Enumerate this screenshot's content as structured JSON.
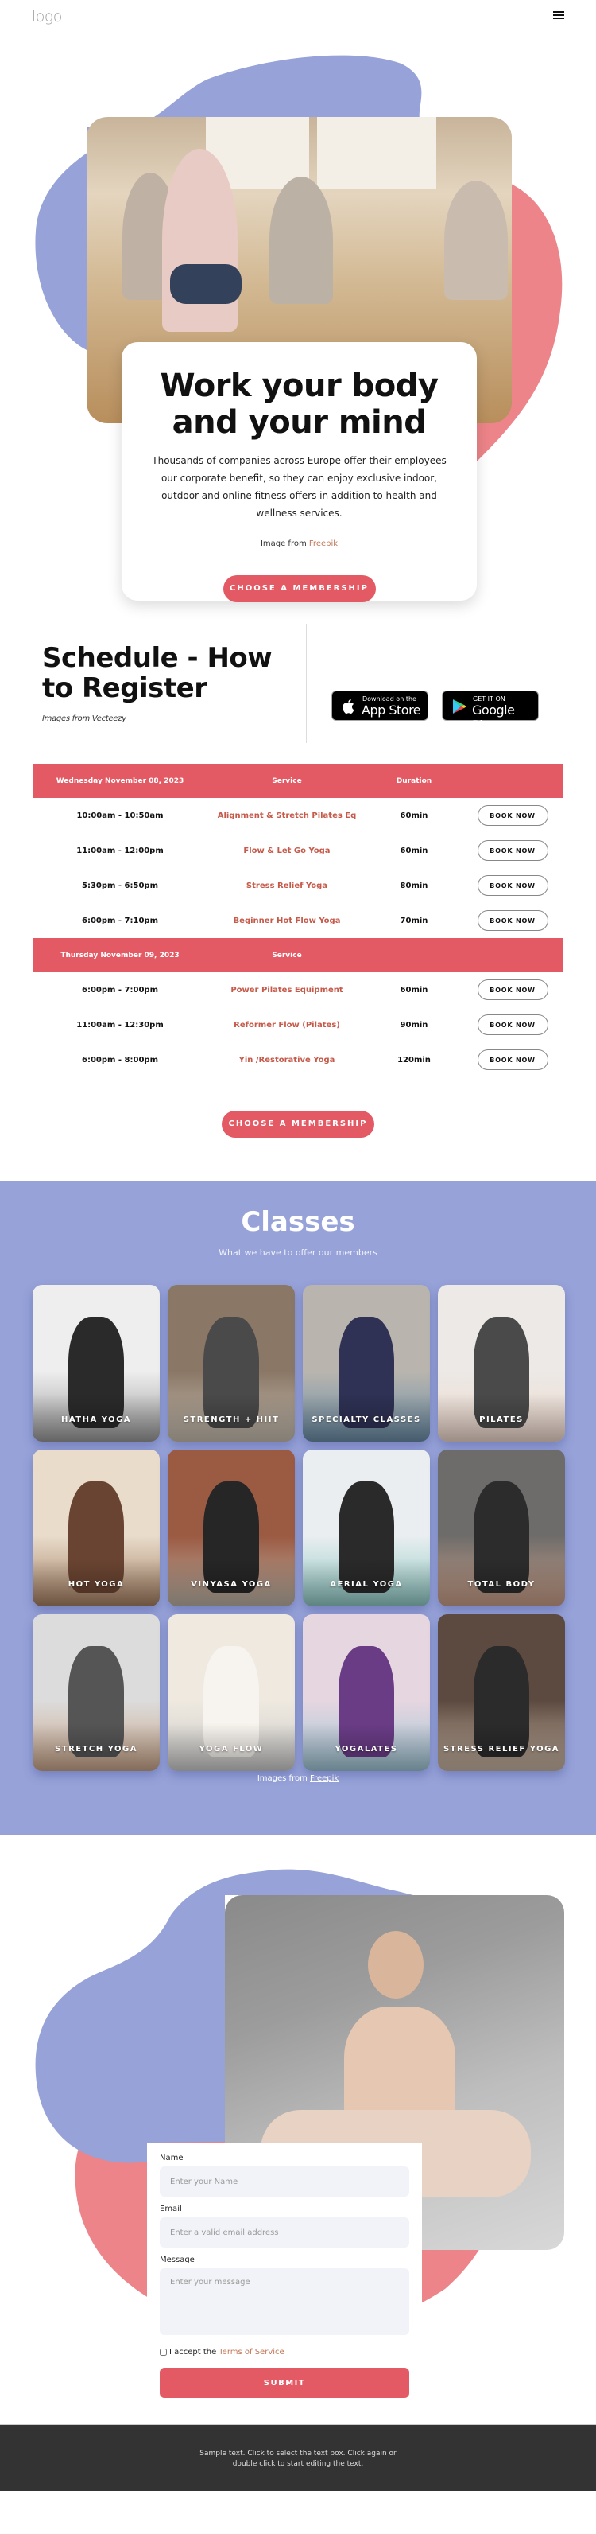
{
  "header": {
    "logo": "logo",
    "menu_icon": "hamburger-icon"
  },
  "colors": {
    "accent": "#e35a64",
    "periwinkle": "#96a2d8",
    "coral_blob": "#ec8489",
    "link": "#c0785a",
    "footer_bg": "#333333"
  },
  "hero": {
    "title_line1": "Work your body",
    "title_line2": "and your mind",
    "text": "Thousands of companies across Europe offer their employees our corporate benefit, so they can enjoy exclusive indoor, outdoor and online fitness offers in addition to health and wellness services.",
    "credit_prefix": "Image from",
    "credit_link": "Freepik",
    "cta": "CHOOSE A MEMBERSHIP"
  },
  "schedule": {
    "title_line1": "Schedule - How",
    "title_line2": "to Register",
    "credit_prefix": "Images from",
    "credit_link": "Vecteezy",
    "app_store": {
      "small": "Download on the",
      "big": "App Store"
    },
    "google_play": {
      "small": "GET IT ON",
      "big": "Google Play"
    },
    "days": [
      {
        "headers": [
          "Wednesday November 08, 2023",
          "Service",
          "Duration",
          ""
        ],
        "rows": [
          {
            "time": "10:00am - 10:50am",
            "service": "Alignment & Stretch Pilates Eq",
            "duration": "60min",
            "action": "BOOK NOW"
          },
          {
            "time": "11:00am - 12:00pm",
            "service": "Flow & Let Go Yoga",
            "duration": "60min",
            "action": "BOOK NOW"
          },
          {
            "time": "5:30pm - 6:50pm",
            "service": "Stress Relief Yoga",
            "duration": "80min",
            "action": "BOOK NOW"
          },
          {
            "time": "6:00pm - 7:10pm",
            "service": "Beginner Hot Flow Yoga",
            "duration": "70min",
            "action": "BOOK NOW"
          }
        ]
      },
      {
        "headers": [
          "Thursday November 09, 2023",
          "Service",
          "",
          ""
        ],
        "rows": [
          {
            "time": "6:00pm - 7:00pm",
            "service": "Power Pilates Equipment",
            "duration": "60min",
            "action": "BOOK NOW"
          },
          {
            "time": "11:00am - 12:30pm",
            "service": "Reformer Flow (Pilates)",
            "duration": "90min",
            "action": "BOOK NOW"
          },
          {
            "time": "6:00pm - 8:00pm",
            "service": "Yin /Restorative Yoga",
            "duration": "120min",
            "action": "BOOK NOW"
          }
        ]
      }
    ],
    "cta": "CHOOSE A MEMBERSHIP"
  },
  "classes": {
    "title": "Classes",
    "subtitle": "What we have to offer our members",
    "items": [
      {
        "label": "HATHA YOGA"
      },
      {
        "label": "STRENGTH + HIIT"
      },
      {
        "label": "SPECIALTY CLASSES"
      },
      {
        "label": "PILATES"
      },
      {
        "label": "HOT YOGA"
      },
      {
        "label": "VINYASA YOGA"
      },
      {
        "label": "AERIAL YOGA"
      },
      {
        "label": "TOTAL BODY"
      },
      {
        "label": "STRETCH YOGA"
      },
      {
        "label": "YOGA FLOW"
      },
      {
        "label": "YOGALATES"
      },
      {
        "label": "STRESS RELIEF YOGA"
      }
    ],
    "credit_prefix": "Images from",
    "credit_link": "Freepik"
  },
  "contact": {
    "name_label": "Name",
    "name_placeholder": "Enter your Name",
    "email_label": "Email",
    "email_placeholder": "Enter a valid email address",
    "message_label": "Message",
    "message_placeholder": "Enter your message",
    "terms_prefix": "I accept the",
    "terms_link": "Terms of Service",
    "terms_checked": false,
    "submit": "SUBMIT"
  },
  "footer": {
    "text": "Sample text. Click to select the text box. Click again or double click to start editing the text."
  }
}
